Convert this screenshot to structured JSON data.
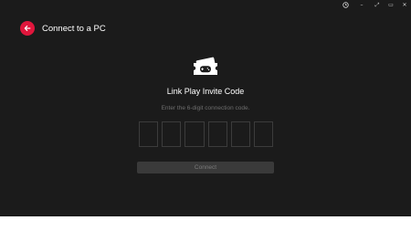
{
  "window": {
    "controls": {
      "history_icon": "clock-icon",
      "minimize_label": "–",
      "expand_label": "⤢",
      "restore_label": "▭",
      "close_label": "✕"
    }
  },
  "header": {
    "back_icon": "arrow-left-icon",
    "title": "Connect to a PC"
  },
  "main": {
    "hero_icon": "game-ticket-icon",
    "title": "Link Play Invite Code",
    "subtitle": "Enter the 6-digit connection code.",
    "code_digits": [
      "",
      "",
      "",
      "",
      "",
      ""
    ],
    "connect_label": "Connect"
  },
  "colors": {
    "background": "#1b1b1b",
    "accent": "#e0163c",
    "button_disabled": "#3a3a3a",
    "text_primary": "#ffffff",
    "text_muted": "#6e6e6e"
  }
}
